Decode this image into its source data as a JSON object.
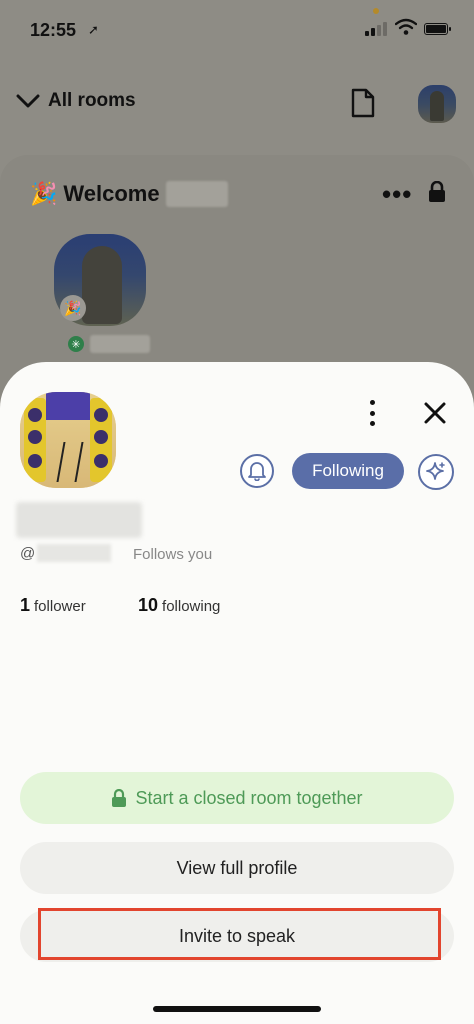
{
  "status_bar": {
    "time": "12:55"
  },
  "background": {
    "nav": {
      "back_label": "All rooms"
    },
    "room": {
      "title_prefix": "Welcome"
    }
  },
  "profile_sheet": {
    "handle_prefix": "@",
    "follows_you": "Follows you",
    "stats": {
      "followers_count": "1",
      "followers_label": "follower",
      "following_count": "10",
      "following_label": "following"
    },
    "following_button": "Following",
    "actions": {
      "closed_room": "Start a closed room together",
      "view_profile": "View full profile",
      "invite_speak": "Invite to speak"
    }
  },
  "colors": {
    "accent_blue": "#5a6ea8",
    "closed_room_green": "#4e9a57",
    "closed_room_bg": "#e3f5d8",
    "highlight_red": "#e2452e"
  },
  "icons": [
    "location-arrow-icon",
    "signal-icon",
    "wifi-icon",
    "battery-icon",
    "chevron-down-icon",
    "document-icon",
    "party-popper-icon",
    "more-icon",
    "lock-icon",
    "bell-icon",
    "sparkle-icon",
    "close-icon"
  ]
}
